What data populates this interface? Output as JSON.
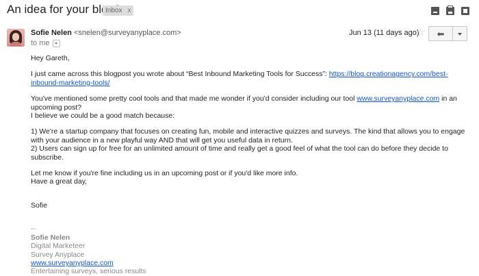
{
  "header": {
    "subject": "An idea for your blog?",
    "label": "Inbox",
    "label_close": "x",
    "icons": [
      "expand-icon",
      "print-icon",
      "open-in-new-window-icon"
    ]
  },
  "message": {
    "sender_name": "Sofie Nelen",
    "sender_email": "<snelen@surveyanyplace.com>",
    "to": "to me",
    "date": "Jun 13 (11 days ago)",
    "star": "☆",
    "reply_icon": "reply-icon",
    "more_icon": "chevron-down-icon"
  },
  "body": {
    "greeting": "Hey Gareth,",
    "p1": "I just came across this blogpost you wrote about “Best Inbound Marketing Tools for Success”: ",
    "p1_link": "https://blog.creationagency.com/best-inbound-marketing-tools/",
    "p2_a": "You've mentioned some pretty cool tools and that made me wonder if you'd consider including our tool ",
    "p2_link": "www.surveyanyplace.com",
    "p2_b": " in an upcoming post?",
    "p3": "I believe we could be a good match because:",
    "li1": "1) We're a startup company that focuses on creating fun, mobile and interactive quizzes and surveys. The kind that allows you to engage with your audience in a new playful way AND that will get you useful data in return.",
    "li2": "2) Users can sign up for free for an unlimited amount of time and really get a good feel of what the tool can do before they decide to subscribe.",
    "p4": "Let me know if you're fine including us in an upcoming post or if you'd like more info.",
    "p5": "Have a great day,",
    "closing": "Sofie"
  },
  "signature": {
    "separator": "--",
    "name": "Sofie Nelen",
    "title": "Digital Marketeer",
    "company": "Survey Anyplace",
    "website": "www.surveyanyplace.com",
    "tagline": "Entertaining surveys, serious results"
  }
}
